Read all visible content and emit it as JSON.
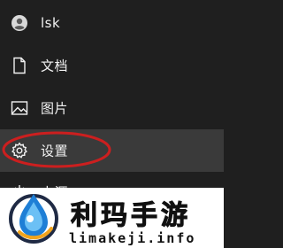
{
  "menu": {
    "items": [
      {
        "label": "lsk",
        "icon": "user-avatar-icon"
      },
      {
        "label": "文档",
        "icon": "document-icon"
      },
      {
        "label": "图片",
        "icon": "picture-icon"
      },
      {
        "label": "设置",
        "icon": "gear-icon",
        "selected": true
      },
      {
        "label": "电源",
        "icon": "power-icon"
      }
    ]
  },
  "annotation": {
    "ring_color": "#cc1f1f"
  },
  "watermark": {
    "title": "利玛手游",
    "url": "limakeji.info"
  }
}
